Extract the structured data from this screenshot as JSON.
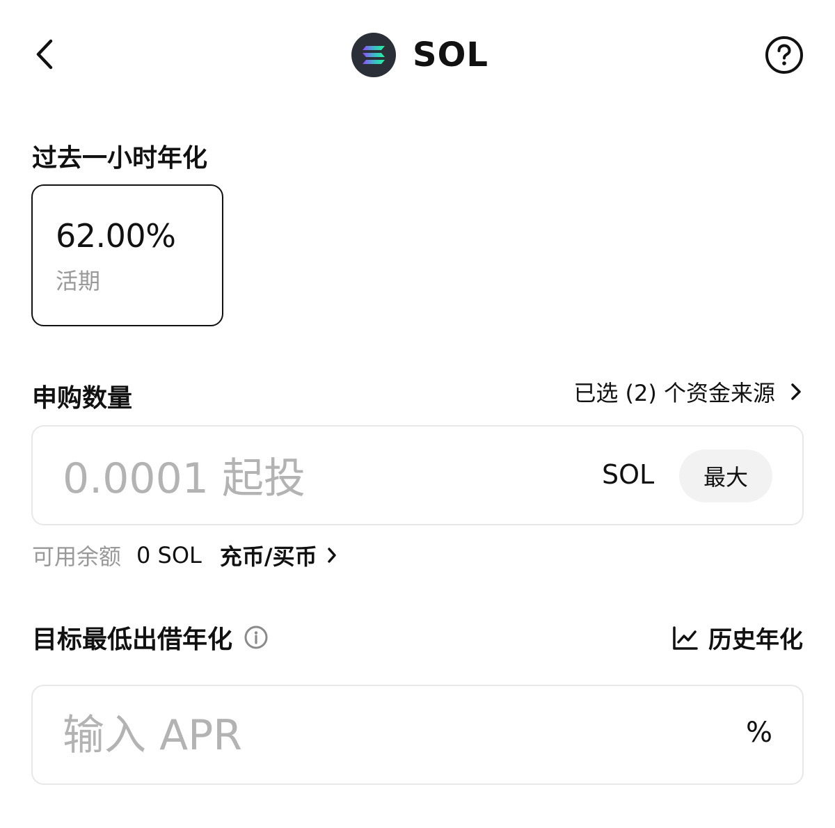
{
  "header": {
    "title": "SOL",
    "icons": {
      "back": "back-chevron-icon",
      "logo": "solana-logo-icon",
      "help": "help-circle-icon"
    }
  },
  "apr_section": {
    "label": "过去一小时年化",
    "card": {
      "value": "62.00%",
      "type": "活期"
    }
  },
  "subscribe": {
    "label": "申购数量",
    "sources_link": "已选 (2) 个资金来源",
    "amount_input": {
      "value": "",
      "placeholder": "0.0001 起投"
    },
    "unit": "SOL",
    "max_label": "最大",
    "balance_label": "可用余额",
    "balance_value": "0 SOL",
    "deposit_link": "充币/买币"
  },
  "target_apr": {
    "label": "目标最低出借年化",
    "history_link": "历史年化",
    "input": {
      "value": "",
      "placeholder": "输入 APR"
    },
    "unit": "%"
  },
  "colors": {
    "text": "#111111",
    "muted": "#999999",
    "placeholder": "#b3b3b3",
    "border": "#e8e8e8",
    "chip_bg": "#f2f2f2",
    "logo_bg": "#2b2f37"
  }
}
